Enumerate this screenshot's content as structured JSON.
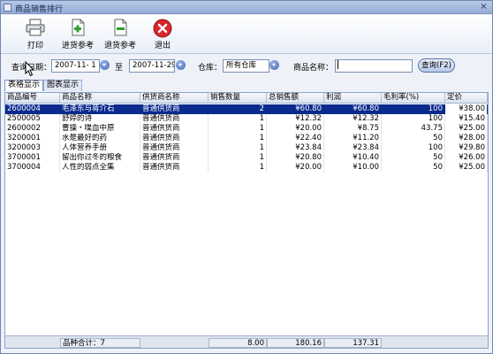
{
  "window": {
    "title": "商品销售排行"
  },
  "toolbar": {
    "print_label": "打印",
    "purchase_ref_label": "进货参考",
    "return_ref_label": "退货参考",
    "exit_label": "退出"
  },
  "filter": {
    "date_label": "查询日期：",
    "date_from": "2007-11- 1",
    "to_label": "至",
    "date_to": "2007-11-29",
    "warehouse_label": "仓库：",
    "warehouse_value": "所有仓库",
    "product_name_label": "商品名称：",
    "product_name_value": "",
    "search_label": "查询(F2)"
  },
  "tabs": [
    {
      "label": "表格显示",
      "active": true
    },
    {
      "label": "图表显示",
      "active": false
    }
  ],
  "table": {
    "columns": [
      "商品编号",
      "商品名称",
      "供货商名称",
      "销售数量",
      "总销售额",
      "利润",
      "毛利率(%)",
      "定价"
    ],
    "rows": [
      [
        "2600004",
        "毛泽东与蒋介石",
        "普通供货商",
        "2",
        "¥60.80",
        "¥60.80",
        "100",
        "¥38.00"
      ],
      [
        "2500005",
        "舒婷的诗",
        "普通供货商",
        "1",
        "¥12.32",
        "¥12.32",
        "100",
        "¥15.40"
      ],
      [
        "2600002",
        "曹操・喋血中原",
        "普通供货商",
        "1",
        "¥20.00",
        "¥8.75",
        "43.75",
        "¥25.00"
      ],
      [
        "3200001",
        "水是最好的药",
        "普通供货商",
        "1",
        "¥22.40",
        "¥11.20",
        "50",
        "¥28.00"
      ],
      [
        "3200003",
        "人体营养手册",
        "普通供货商",
        "1",
        "¥23.84",
        "¥23.84",
        "100",
        "¥29.80"
      ],
      [
        "3700001",
        "留出你过冬的粮食",
        "普通供货商",
        "1",
        "¥20.80",
        "¥10.40",
        "50",
        "¥26.00"
      ],
      [
        "3700004",
        "人性的弱点全集",
        "普通供货商",
        "1",
        "¥20.00",
        "¥10.00",
        "50",
        "¥25.00"
      ]
    ],
    "selected_row": 0
  },
  "footer": {
    "count_label": "品种合计：7",
    "qty_total": "8.00",
    "sales_total": "180.16",
    "profit_total": "137.31"
  },
  "icons": {
    "print": "printer-icon",
    "purchase_ref": "document-plus-icon",
    "return_ref": "document-minus-icon",
    "exit": "close-circle-icon"
  },
  "colors": {
    "selection": "#0a2a8e",
    "exit_red": "#d8262c",
    "add_green": "#2f9e2f"
  }
}
